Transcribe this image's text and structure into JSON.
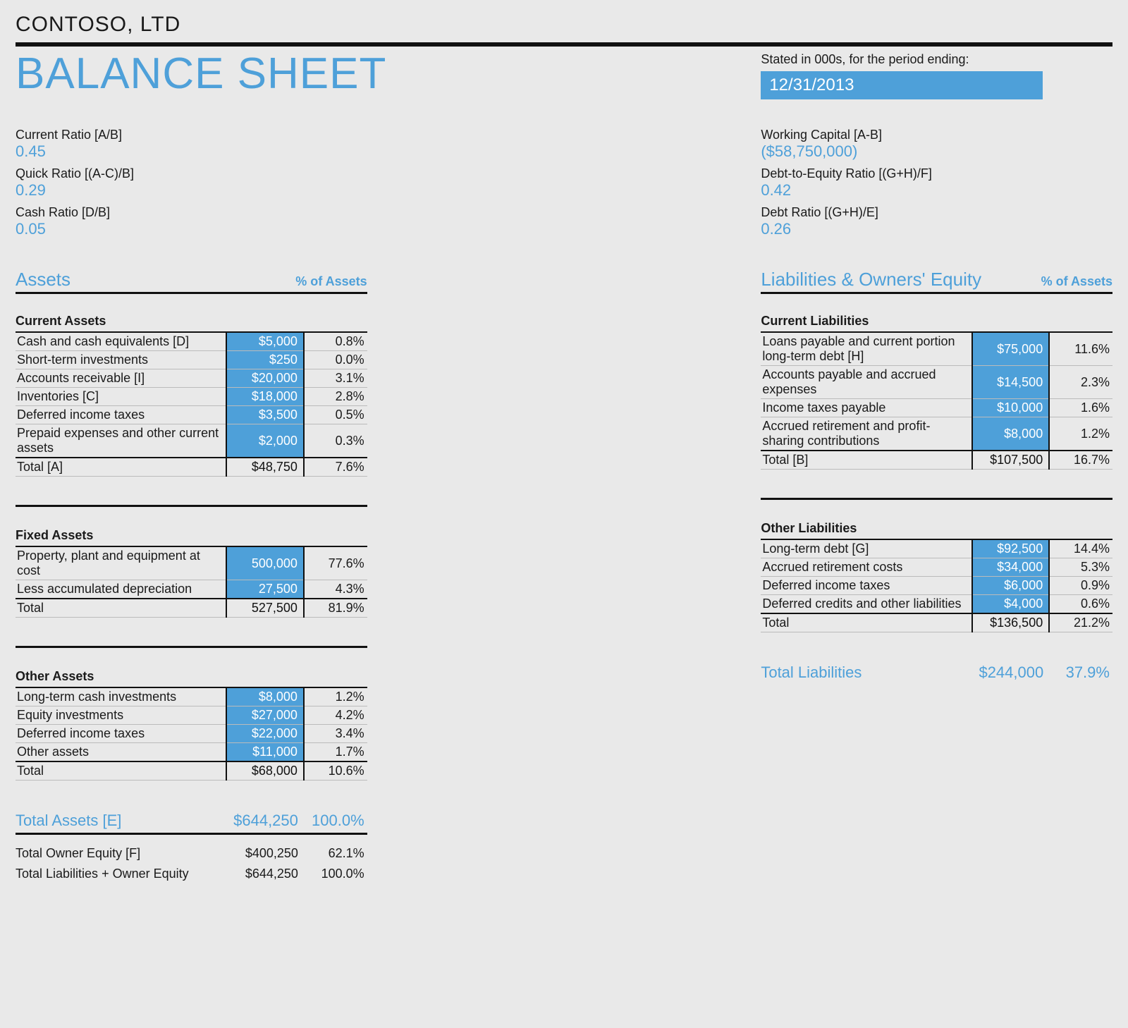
{
  "company": "CONTOSO, LTD",
  "title": "BALANCE SHEET",
  "period": {
    "label": "Stated in 000s, for the period ending:",
    "value": "12/31/2013"
  },
  "ratios_left": [
    {
      "label": "Current Ratio   [A/B]",
      "value": "0.45"
    },
    {
      "label": "Quick Ratio   [(A-C)/B]",
      "value": "0.29"
    },
    {
      "label": "Cash Ratio   [D/B]",
      "value": "0.05"
    }
  ],
  "ratios_right": [
    {
      "label": "Working Capital   [A-B]",
      "value": "($58,750,000)"
    },
    {
      "label": "Debt-to-Equity Ratio   [(G+H)/F]",
      "value": "0.42"
    },
    {
      "label": "Debt Ratio   [(G+H)/E]",
      "value": "0.26"
    }
  ],
  "left": {
    "heading": "Assets",
    "pct_label": "% of Assets",
    "groups": [
      {
        "name": "Current Assets",
        "rows": [
          {
            "label": "Cash and cash equivalents   [D]",
            "value": "$5,000",
            "pct": "0.8%"
          },
          {
            "label": "Short-term investments",
            "value": "$250",
            "pct": "0.0%"
          },
          {
            "label": "Accounts receivable   [I]",
            "value": "$20,000",
            "pct": "3.1%"
          },
          {
            "label": "Inventories   [C]",
            "value": "$18,000",
            "pct": "2.8%"
          },
          {
            "label": "Deferred income taxes",
            "value": "$3,500",
            "pct": "0.5%"
          },
          {
            "label": "Prepaid expenses and other current assets",
            "value": "$2,000",
            "pct": "0.3%"
          }
        ],
        "total": {
          "label": "Total   [A]",
          "value": "$48,750",
          "pct": "7.6%"
        }
      },
      {
        "name": "Fixed Assets",
        "rows": [
          {
            "label": "Property, plant and equipment at cost",
            "value": "500,000",
            "pct": "77.6%"
          },
          {
            "label": "Less accumulated depreciation",
            "value": "27,500",
            "pct": "4.3%"
          }
        ],
        "total": {
          "label": "Total",
          "value": "527,500",
          "pct": "81.9%"
        }
      },
      {
        "name": "Other Assets",
        "rows": [
          {
            "label": "Long-term cash investments",
            "value": "$8,000",
            "pct": "1.2%"
          },
          {
            "label": "Equity investments",
            "value": "$27,000",
            "pct": "4.2%"
          },
          {
            "label": "Deferred income taxes",
            "value": "$22,000",
            "pct": "3.4%"
          },
          {
            "label": "Other assets",
            "value": "$11,000",
            "pct": "1.7%"
          }
        ],
        "total": {
          "label": "Total",
          "value": "$68,000",
          "pct": "10.6%"
        }
      }
    ],
    "grand": {
      "label": "Total Assets   [E]",
      "value": "$644,250",
      "pct": "100.0%"
    },
    "equity_rows": [
      {
        "label": "Total Owner Equity   [F]",
        "value": "$400,250",
        "pct": "62.1%"
      },
      {
        "label": "Total Liabilities + Owner Equity",
        "value": "$644,250",
        "pct": "100.0%"
      }
    ]
  },
  "right": {
    "heading": "Liabilities & Owners' Equity",
    "pct_label": "% of Assets",
    "groups": [
      {
        "name": "Current Liabilities",
        "rows": [
          {
            "label": "Loans payable and current portion long-term debt   [H]",
            "value": "$75,000",
            "pct": "11.6%"
          },
          {
            "label": "Accounts payable and accrued expenses",
            "value": "$14,500",
            "pct": "2.3%"
          },
          {
            "label": "Income taxes payable",
            "value": "$10,000",
            "pct": "1.6%"
          },
          {
            "label": "Accrued retirement and profit-sharing contributions",
            "value": "$8,000",
            "pct": "1.2%"
          }
        ],
        "total": {
          "label": "Total   [B]",
          "value": "$107,500",
          "pct": "16.7%"
        }
      },
      {
        "name": "Other Liabilities",
        "rows": [
          {
            "label": "Long-term debt   [G]",
            "value": "$92,500",
            "pct": "14.4%"
          },
          {
            "label": "Accrued retirement costs",
            "value": "$34,000",
            "pct": "5.3%"
          },
          {
            "label": "Deferred income taxes",
            "value": "$6,000",
            "pct": "0.9%"
          },
          {
            "label": "Deferred credits and other liabilities",
            "value": "$4,000",
            "pct": "0.6%"
          }
        ],
        "total": {
          "label": "Total",
          "value": "$136,500",
          "pct": "21.2%"
        }
      }
    ],
    "grand": {
      "label": "Total Liabilities",
      "value": "$244,000",
      "pct": "37.9%"
    }
  }
}
